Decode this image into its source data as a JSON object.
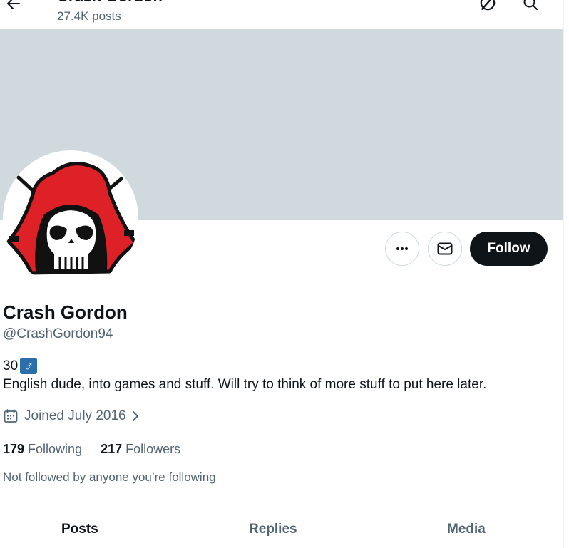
{
  "header": {
    "name": "Crash Gordon",
    "posts_count": "27.4K posts"
  },
  "profile": {
    "display_name": "Crash Gordon",
    "handle": "@CrashGordon94",
    "bio_age": "30",
    "bio_symbol": "♂",
    "bio_text": "English dude, into games and stuff. Will try to think of more stuff to put here later.",
    "joined": "Joined July 2016",
    "following_count": "179",
    "following_label": "Following",
    "followers_count": "217",
    "followers_label": "Followers",
    "not_followed_text": "Not followed by anyone you’re following"
  },
  "actions": {
    "follow_label": "Follow",
    "more_icon": "more-icon",
    "message_icon": "mail-icon"
  },
  "tabs": [
    {
      "label": "Posts",
      "active": true
    },
    {
      "label": "Replies",
      "active": false
    },
    {
      "label": "Media",
      "active": false
    }
  ],
  "colors": {
    "banner": "#cfd9de",
    "follow_button": "#0f1419",
    "secondary_text": "#536471",
    "avatar_hood_red": "#dd2127"
  }
}
